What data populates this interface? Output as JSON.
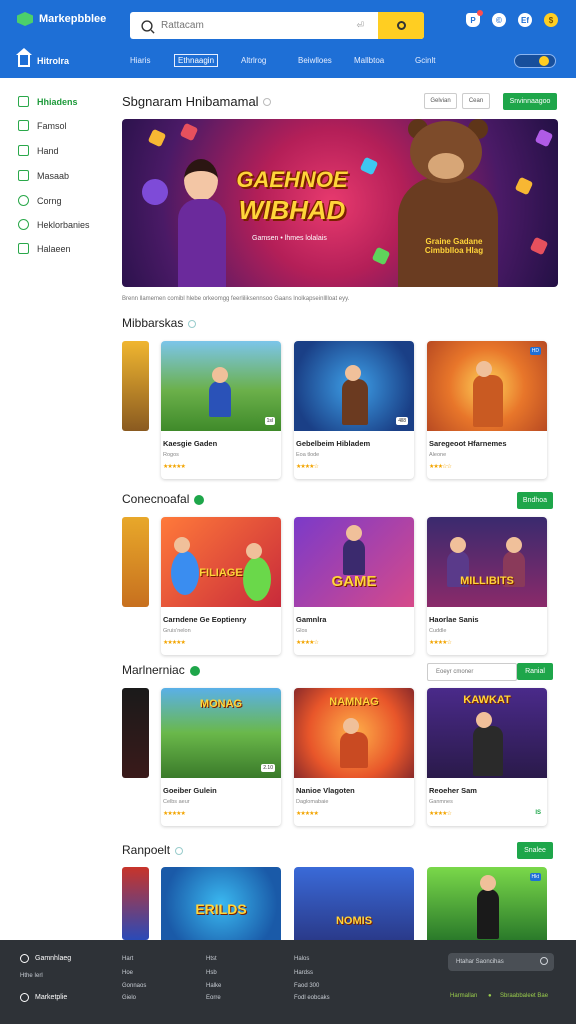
{
  "header": {
    "brand": "Markepbblee",
    "search_placeholder": "Rattacam",
    "search_hint": "⏎",
    "home_label": "Hitrolra",
    "tabs": [
      "Hiaris",
      "Ethnaagin",
      "Altrlrog",
      "Beiwlloes",
      "Mallbtoa",
      "Gcinlt"
    ],
    "active_tab": 1,
    "icon_labels": [
      "P",
      "©",
      "Ef"
    ]
  },
  "sidebar": {
    "items": [
      {
        "label": "Hhiadens",
        "icon": "grid-icon"
      },
      {
        "label": "Famsol",
        "icon": "gamepad-icon"
      },
      {
        "label": "Hand",
        "icon": "list-icon"
      },
      {
        "label": "Masaab",
        "icon": "chat-icon"
      },
      {
        "label": "Corng",
        "icon": "coin-icon"
      },
      {
        "label": "Heklorbanies",
        "icon": "help-icon"
      },
      {
        "label": "Halaeen",
        "icon": "share-icon"
      }
    ]
  },
  "featured": {
    "title": "Sbgnaram Hnibamamal",
    "btn_a": "Gelvian",
    "btn_b": "Cean",
    "btn_primary": "Snvinnaagoo",
    "hero_title_1": "GAEHNOE",
    "hero_title_2": "WIBHAD",
    "hero_tagline": "Gamsen • lhmes lolalais",
    "hero_sign": "Graine Gadane\nCimbblloa Hlag",
    "caption": "Brenn llamemen comibl hlebe orkeomgg feerliliksennsoo  Gaans  lnolkapseinlllloat eyy."
  },
  "sections": [
    {
      "title": "Mibbarskas",
      "marker": "ring",
      "cards": [
        {
          "name": "Kaesgie Gaden",
          "meta": "Rogos",
          "stars": "★★★★★",
          "badge": "1sl",
          "sub": ""
        },
        {
          "name": "Gebelbeim Hibladem",
          "meta": "Eoa tlode",
          "stars": "★★★★☆",
          "badge": "4ll8",
          "sub": ""
        },
        {
          "name": "Saregeoot Hfarnemes",
          "meta": "Aleone",
          "stars": "★★★☆☆",
          "badge": "HD",
          "sub": ""
        }
      ]
    },
    {
      "title": "Conecnoafal",
      "marker": "check",
      "action": "Bndhoa",
      "cards": [
        {
          "name": "Carndene Ge Eoptienry",
          "meta": "Gruis'nelon",
          "stars": "★★★★★",
          "badge": "",
          "sub": "FILIAGE"
        },
        {
          "name": "Gamnlra",
          "meta": "Glos",
          "stars": "★★★★☆",
          "badge": "",
          "sub": "GAME"
        },
        {
          "name": "Haorlae Sanis",
          "meta": "Cuddle",
          "stars": "★★★★☆",
          "badge": "",
          "sub": "MILLIBITS"
        }
      ]
    },
    {
      "title": "Marlnerniac",
      "marker": "check",
      "input_placeholder": "Eoeyr cmoner",
      "action": "Ranial",
      "cards": [
        {
          "name": "Goeiber Gulein",
          "meta": "Celbs aeur",
          "stars": "★★★★★",
          "badge": "2.10",
          "sub": "MONAG"
        },
        {
          "name": "Nanioe Vlagoten",
          "meta": "Daglomabaie",
          "stars": "★★★★★",
          "badge": "",
          "sub": "NAMNAG"
        },
        {
          "name": "Reoeher Sam",
          "meta": "Ganmnes",
          "stars": "★★★★☆",
          "badge": "",
          "sub": "KAWKAT",
          "tag": "IS"
        }
      ]
    },
    {
      "title": "Ranpoelt",
      "marker": "ring",
      "action": "Snalee",
      "cards": [
        {
          "name": "",
          "meta": "",
          "stars": "",
          "badge": "",
          "sub": "ERILDS"
        },
        {
          "name": "",
          "meta": "",
          "stars": "",
          "badge": "",
          "sub": "NOMIS"
        },
        {
          "name": "",
          "meta": "",
          "stars": "",
          "badge": "Hkt",
          "sub": ""
        }
      ]
    }
  ],
  "footer": {
    "brand_top": "Gamnhlaeg",
    "brand_bottom": "Marketplie",
    "sub_link": "Hthe Ierl",
    "col1": [
      "Hart",
      "Hoe",
      "Gonnaos",
      "Gielo"
    ],
    "col2": [
      "Htst",
      "Hsb",
      "Halke",
      "Eorre"
    ],
    "col3": [
      "Halos",
      "Hardss",
      "Faod 300",
      "Fodl eobcaks"
    ],
    "search_placeholder": "Htahar Saoncihas",
    "right_a": "Harmallan",
    "right_b": "Sbraabbaleet Bae"
  },
  "colors": {
    "brand_blue": "#1e6fd6",
    "accent_green": "#1ea64a",
    "accent_yellow": "#ffce22",
    "footer_bg": "#2e3237"
  }
}
